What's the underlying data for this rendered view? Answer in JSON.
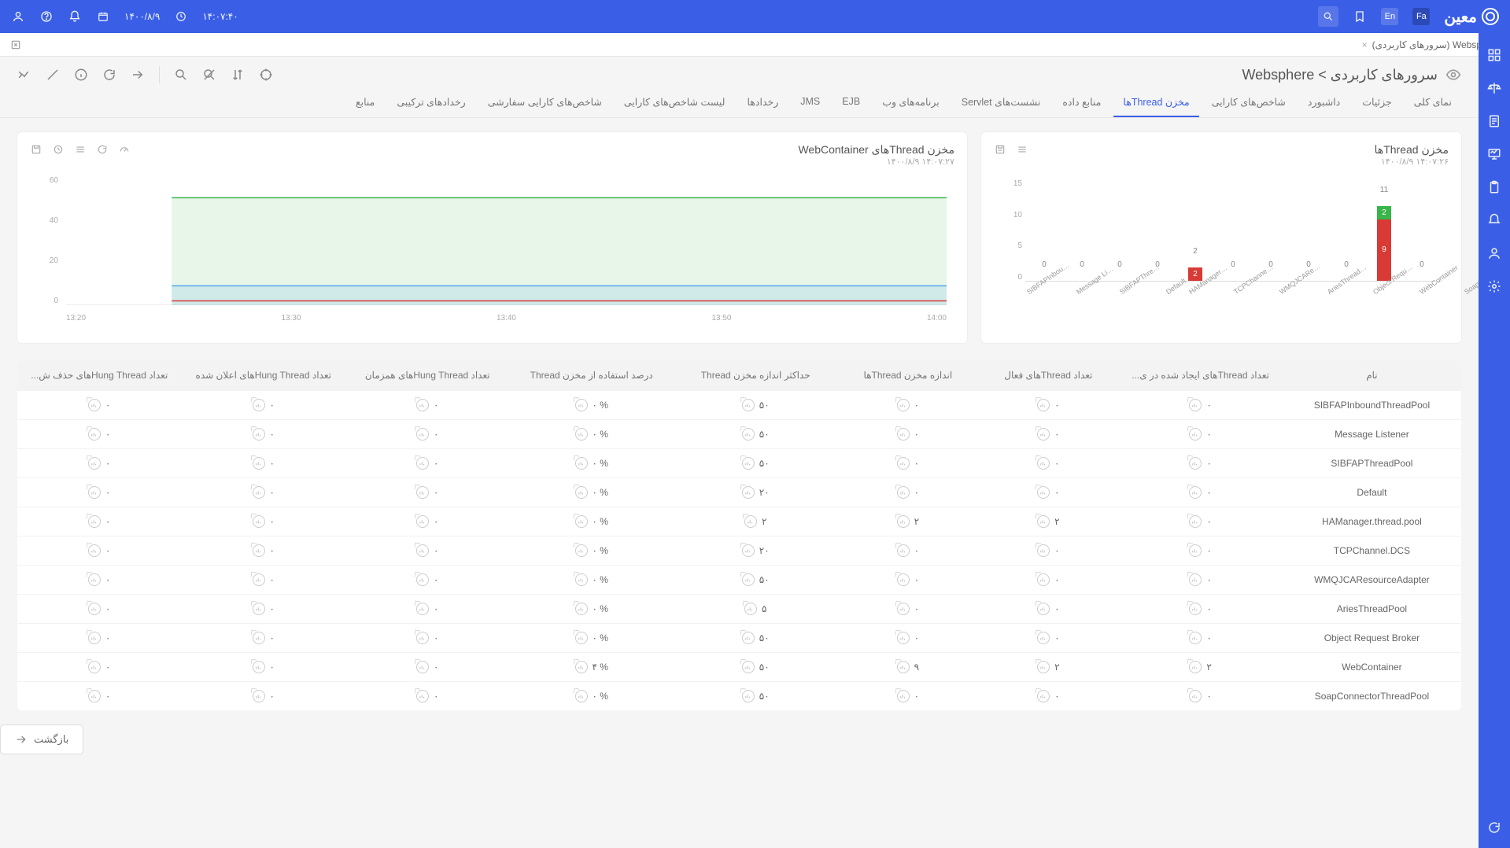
{
  "topbar": {
    "date": "۱۴۰۰/۸/۹",
    "time": "۱۴:۰۷:۴۰",
    "lang_en": "En",
    "lang_fa": "Fa",
    "logo": "معین"
  },
  "secbar": {
    "crumb": "Websphere (سرورهای کاربردی)"
  },
  "page": {
    "title": "سرورهای کاربردی > Websphere"
  },
  "tabs": [
    "نمای کلی",
    "جزئیات",
    "داشبورد",
    "شاخص‌های کارایی",
    "مخزن Threadها",
    "منابع داده",
    "نشست‌های Servlet",
    "برنامه‌های وب",
    "EJB",
    "JMS",
    "رخدادها",
    "لیست شاخص‌های کارایی",
    "شاخص‌های کارایی سفارشی",
    "رخدادهای ترکیبی",
    "منابع"
  ],
  "active_tab_index": 4,
  "panel_bar": {
    "title": "مخزن Threadها",
    "time": "۱۴:۰۷:۲۶   ۱۴۰۰/۸/۹",
    "chart_data": {
      "type": "bar",
      "ylim": [
        0,
        15
      ],
      "yticks": [
        0,
        5,
        10,
        15
      ],
      "categories": [
        "SIBFAPInbou…",
        "Message Li…",
        "SIBFAPThre…",
        "Default",
        "HAManager…",
        "TCPChanne…",
        "WMQJCARe…",
        "AriesThread…",
        "Object Requ…",
        "WebContainer",
        "SoapConnec…"
      ],
      "series": [
        {
          "name": "active",
          "color": "#d93a36",
          "values": [
            0,
            0,
            0,
            0,
            2,
            0,
            0,
            0,
            0,
            9,
            0
          ]
        },
        {
          "name": "size",
          "color": "#39b54a",
          "values": [
            0,
            0,
            0,
            0,
            0,
            0,
            0,
            0,
            0,
            2,
            0
          ]
        }
      ],
      "top_labels": [
        0,
        0,
        0,
        0,
        2,
        0,
        0,
        0,
        0,
        11,
        0
      ]
    }
  },
  "panel_line": {
    "title": "مخزن Threadهای WebContainer",
    "time": "۱۴:۰۷:۲۷   ۱۴۰۰/۸/۹",
    "chart_data": {
      "type": "line",
      "ylim": [
        0,
        60
      ],
      "yticks": [
        0,
        20,
        40,
        60
      ],
      "xticks": [
        "13:20",
        "13:30",
        "13:40",
        "13:50",
        "14:00"
      ],
      "series": [
        {
          "name": "max",
          "color": "#39b54a",
          "value": 50,
          "fill": "rgba(57,181,74,0.12)"
        },
        {
          "name": "pool",
          "color": "#4fa6e8",
          "value": 9,
          "fill": "rgba(79,166,232,0.15)"
        },
        {
          "name": "active",
          "color": "#d93a36",
          "value": 2,
          "fill": "none"
        }
      ]
    }
  },
  "table": {
    "headers": [
      "نام",
      "تعداد Threadهای ایجاد شده در ی...",
      "تعداد Threadهای فعال",
      "اندازه مخزن Threadها",
      "حداکثر اندازه مخزن Thread",
      "درصد استفاده از مخزن Thread",
      "تعداد Hung Threadهای همزمان",
      "تعداد Hung Threadهای اعلان شده",
      "تعداد Hung Threadهای حذف ش..."
    ],
    "rows": [
      {
        "name": "SIBFAPInboundThreadPool",
        "vals": [
          "۰",
          "۰",
          "۰",
          "۵۰",
          "۰ %",
          "۰",
          "۰",
          "۰"
        ]
      },
      {
        "name": "Message Listener",
        "vals": [
          "۰",
          "۰",
          "۰",
          "۵۰",
          "۰ %",
          "۰",
          "۰",
          "۰"
        ]
      },
      {
        "name": "SIBFAPThreadPool",
        "vals": [
          "۰",
          "۰",
          "۰",
          "۵۰",
          "۰ %",
          "۰",
          "۰",
          "۰"
        ]
      },
      {
        "name": "Default",
        "vals": [
          "۰",
          "۰",
          "۰",
          "۲۰",
          "۰ %",
          "۰",
          "۰",
          "۰"
        ]
      },
      {
        "name": "HAManager.thread.pool",
        "vals": [
          "۰",
          "۲",
          "۲",
          "۲",
          "۰ %",
          "۰",
          "۰",
          "۰"
        ]
      },
      {
        "name": "TCPChannel.DCS",
        "vals": [
          "۰",
          "۰",
          "۰",
          "۲۰",
          "۰ %",
          "۰",
          "۰",
          "۰"
        ]
      },
      {
        "name": "WMQJCAResourceAdapter",
        "vals": [
          "۰",
          "۰",
          "۰",
          "۵۰",
          "۰ %",
          "۰",
          "۰",
          "۰"
        ]
      },
      {
        "name": "AriesThreadPool",
        "vals": [
          "۰",
          "۰",
          "۰",
          "۵",
          "۰ %",
          "۰",
          "۰",
          "۰"
        ]
      },
      {
        "name": "Object Request Broker",
        "vals": [
          "۰",
          "۰",
          "۰",
          "۵۰",
          "۰ %",
          "۰",
          "۰",
          "۰"
        ]
      },
      {
        "name": "WebContainer",
        "vals": [
          "۲",
          "۲",
          "۹",
          "۵۰",
          "۴ %",
          "۰",
          "۰",
          "۰"
        ]
      },
      {
        "name": "SoapConnectorThreadPool",
        "vals": [
          "۰",
          "۰",
          "۰",
          "۵۰",
          "۰ %",
          "۰",
          "۰",
          "۰"
        ]
      }
    ]
  },
  "back_label": "بازگشت"
}
